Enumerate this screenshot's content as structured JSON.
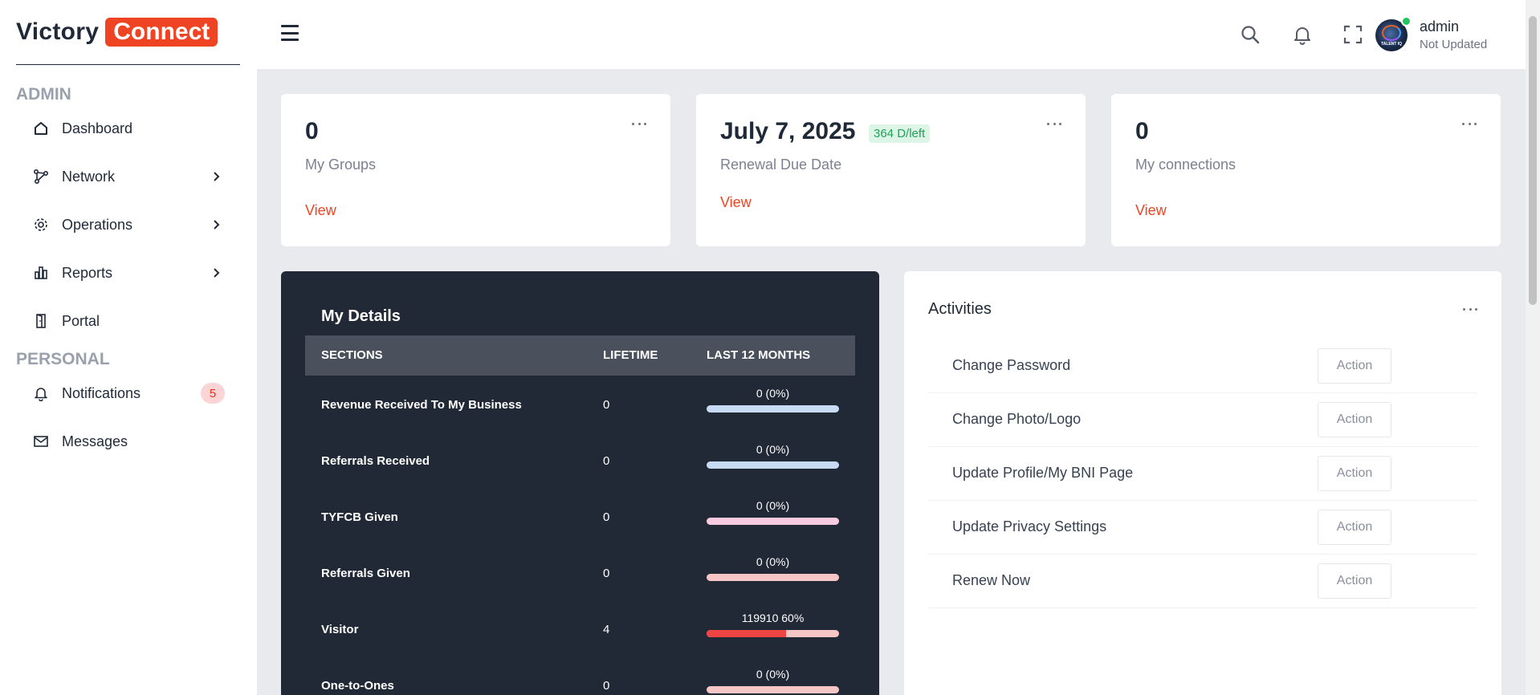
{
  "app": {
    "logo_word1": "Victory",
    "logo_word2": "Connect",
    "brand_color": "#ef4423"
  },
  "sidebar": {
    "section_admin": "ADMIN",
    "section_personal": "PERSONAL",
    "items": [
      {
        "label": "Dashboard",
        "icon": "home-icon"
      },
      {
        "label": "Network",
        "icon": "network-icon",
        "has_submenu": true
      },
      {
        "label": "Operations",
        "icon": "gear-icon",
        "has_submenu": true
      },
      {
        "label": "Reports",
        "icon": "bar-chart-icon",
        "has_submenu": true
      },
      {
        "label": "Portal",
        "icon": "door-icon"
      },
      {
        "label": "Notifications",
        "icon": "bell-icon",
        "badge": "5"
      },
      {
        "label": "Messages",
        "icon": "mail-icon"
      }
    ]
  },
  "topbar": {
    "icons": [
      "menu-icon",
      "search-icon",
      "bell-icon",
      "fullscreen-icon"
    ],
    "user": {
      "name": "admin",
      "status": "Not Updated",
      "avatar_text": "TALENT IQ",
      "online": true
    }
  },
  "stats": [
    {
      "value": "0",
      "label": "My Groups",
      "link": "View"
    },
    {
      "value": "July 7, 2025",
      "badge": "364 D/left",
      "label": "Renewal Due Date",
      "link": "View"
    },
    {
      "value": "0",
      "label": "My connections",
      "link": "View"
    }
  ],
  "details": {
    "title": "My Details",
    "columns": [
      "SECTIONS",
      "LIFETIME",
      "LAST 12 MONTHS"
    ],
    "rows": [
      {
        "section": "Revenue Received To My Business",
        "lifetime": "0",
        "last12": "0 (0%)",
        "progress": 0,
        "track": "#c7dbf5",
        "fill": "#3b82f6"
      },
      {
        "section": "Referrals Received",
        "lifetime": "0",
        "last12": "0 (0%)",
        "progress": 0,
        "track": "#c7dbf5",
        "fill": "#3b82f6"
      },
      {
        "section": "TYFCB Given",
        "lifetime": "0",
        "last12": "0 (0%)",
        "progress": 0,
        "track": "#f9cbe0",
        "fill": "#ec4899"
      },
      {
        "section": "Referrals Given",
        "lifetime": "0",
        "last12": "0 (0%)",
        "progress": 0,
        "track": "#f6c6c6",
        "fill": "#ef4444"
      },
      {
        "section": "Visitor",
        "lifetime": "4",
        "last12": "119910 60%",
        "progress": 0.6,
        "track": "#f6c6c6",
        "fill": "#ef4444"
      },
      {
        "section": "One-to-Ones",
        "lifetime": "0",
        "last12": "0 (0%)",
        "progress": 0,
        "track": "#f6c6c6",
        "fill": "#ef4444"
      }
    ]
  },
  "activities": {
    "title": "Activities",
    "items": [
      {
        "label": "Change Password",
        "action": "Action"
      },
      {
        "label": "Change Photo/Logo",
        "action": "Action"
      },
      {
        "label": "Update Profile/My BNI Page",
        "action": "Action"
      },
      {
        "label": "Update Privacy Settings",
        "action": "Action"
      },
      {
        "label": "Renew Now",
        "action": "Action"
      }
    ]
  }
}
